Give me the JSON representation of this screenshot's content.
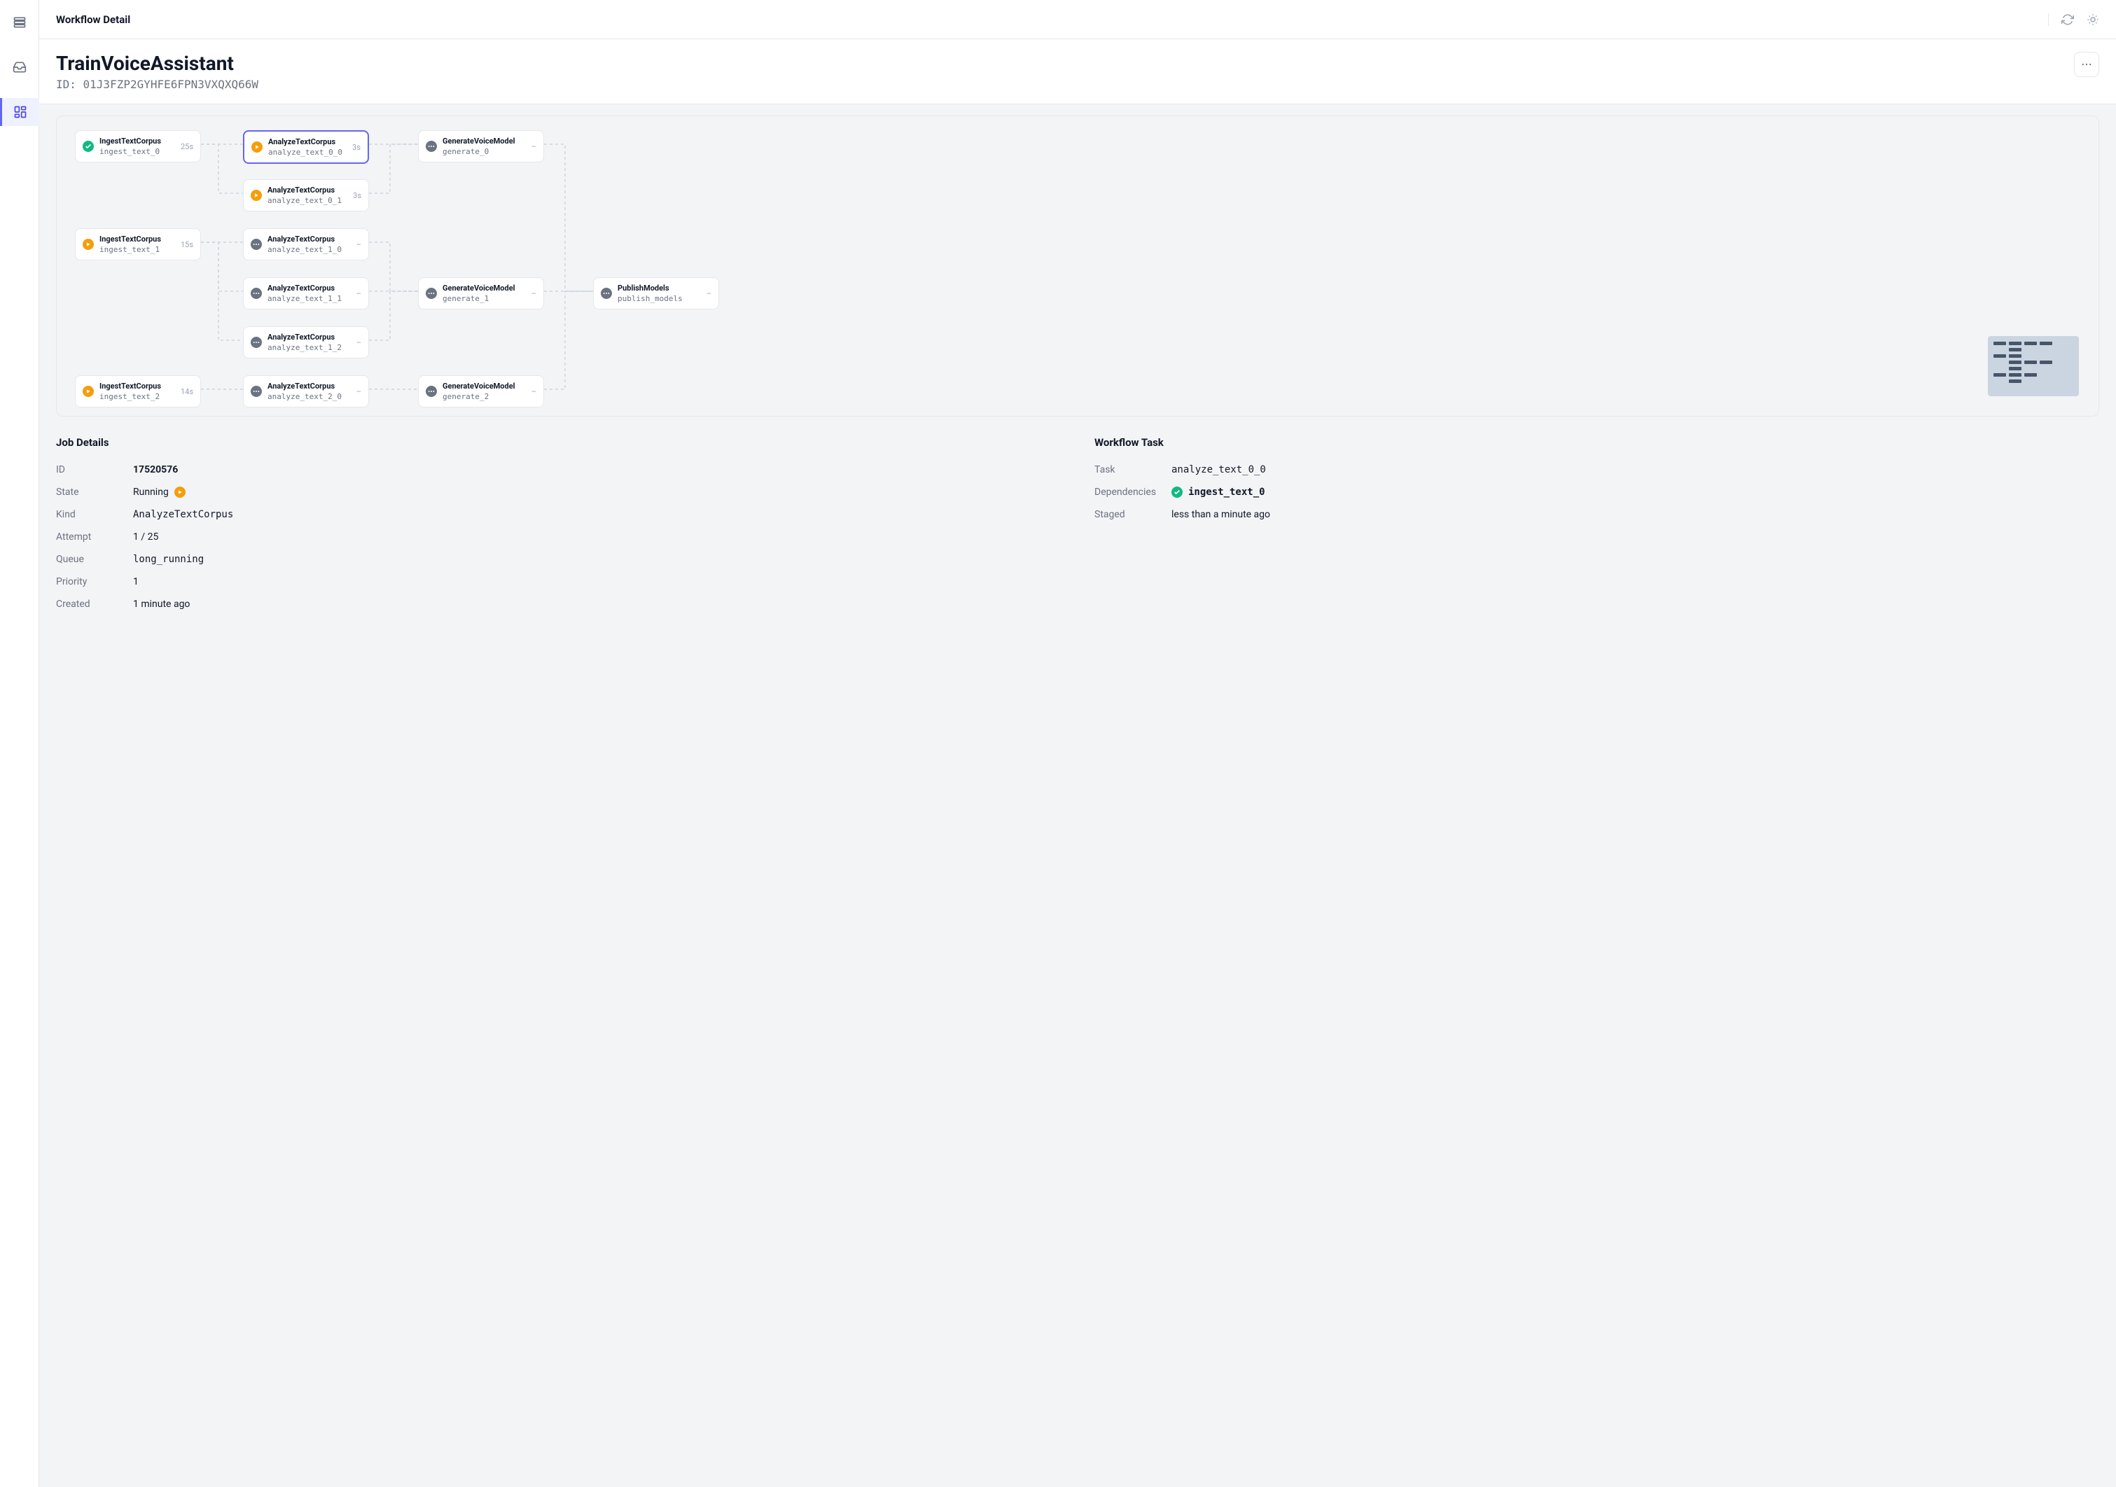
{
  "page": {
    "title": "Workflow Detail"
  },
  "workflow": {
    "name": "TrainVoiceAssistant",
    "id_prefix": "ID: ",
    "id": "01J3FZP2GYHFE6FPN3VXQXQ66W"
  },
  "sidebar": {
    "items": [
      {
        "name": "queues"
      },
      {
        "name": "inbox"
      },
      {
        "name": "workflows"
      }
    ]
  },
  "nodes": {
    "ingest0": {
      "title": "IngestTextCorpus",
      "task": "ingest_text_0",
      "status": "success",
      "dur": "25s"
    },
    "ingest1": {
      "title": "IngestTextCorpus",
      "task": "ingest_text_1",
      "status": "running",
      "dur": "15s"
    },
    "ingest2": {
      "title": "IngestTextCorpus",
      "task": "ingest_text_2",
      "status": "running",
      "dur": "14s"
    },
    "analyze00": {
      "title": "AnalyzeTextCorpus",
      "task": "analyze_text_0_0",
      "status": "running",
      "dur": "3s"
    },
    "analyze01": {
      "title": "AnalyzeTextCorpus",
      "task": "analyze_text_0_1",
      "status": "running",
      "dur": "3s"
    },
    "analyze10": {
      "title": "AnalyzeTextCorpus",
      "task": "analyze_text_1_0",
      "status": "pending",
      "dur": "–"
    },
    "analyze11": {
      "title": "AnalyzeTextCorpus",
      "task": "analyze_text_1_1",
      "status": "pending",
      "dur": "–"
    },
    "analyze12": {
      "title": "AnalyzeTextCorpus",
      "task": "analyze_text_1_2",
      "status": "pending",
      "dur": "–"
    },
    "analyze20": {
      "title": "AnalyzeTextCorpus",
      "task": "analyze_text_2_0",
      "status": "pending",
      "dur": "–"
    },
    "generate0": {
      "title": "GenerateVoiceModel",
      "task": "generate_0",
      "status": "pending",
      "dur": "–"
    },
    "generate1": {
      "title": "GenerateVoiceModel",
      "task": "generate_1",
      "status": "pending",
      "dur": "–"
    },
    "generate2": {
      "title": "GenerateVoiceModel",
      "task": "generate_2",
      "status": "pending",
      "dur": "–"
    },
    "publish": {
      "title": "PublishModels",
      "task": "publish_models",
      "status": "pending",
      "dur": "–"
    }
  },
  "job_details": {
    "title": "Job Details",
    "id_label": "ID",
    "id": "17520576",
    "state_label": "State",
    "state": "Running",
    "kind_label": "Kind",
    "kind": "AnalyzeTextCorpus",
    "attempt_label": "Attempt",
    "attempt": "1 / 25",
    "queue_label": "Queue",
    "queue": "long_running",
    "priority_label": "Priority",
    "priority": "1",
    "created_label": "Created",
    "created": "1 minute ago"
  },
  "workflow_task": {
    "title": "Workflow Task",
    "task_label": "Task",
    "task": "analyze_text_0_0",
    "deps_label": "Dependencies",
    "dep0": "ingest_text_0",
    "staged_label": "Staged",
    "staged": "less than a minute ago"
  }
}
